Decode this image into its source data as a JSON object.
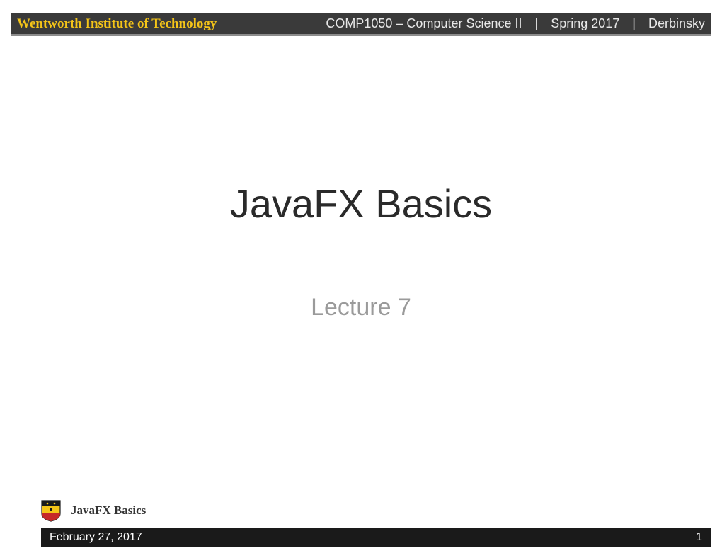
{
  "header": {
    "institute": "Wentworth Institute of Technology",
    "course": "COMP1050 – Computer Science II",
    "term": "Spring 2017",
    "instructor": "Derbinsky",
    "separator": "|"
  },
  "main": {
    "title": "JavaFX Basics",
    "subtitle": "Lecture 7"
  },
  "footer": {
    "topic": "JavaFX Basics",
    "date": "February 27, 2017",
    "page": "1"
  }
}
